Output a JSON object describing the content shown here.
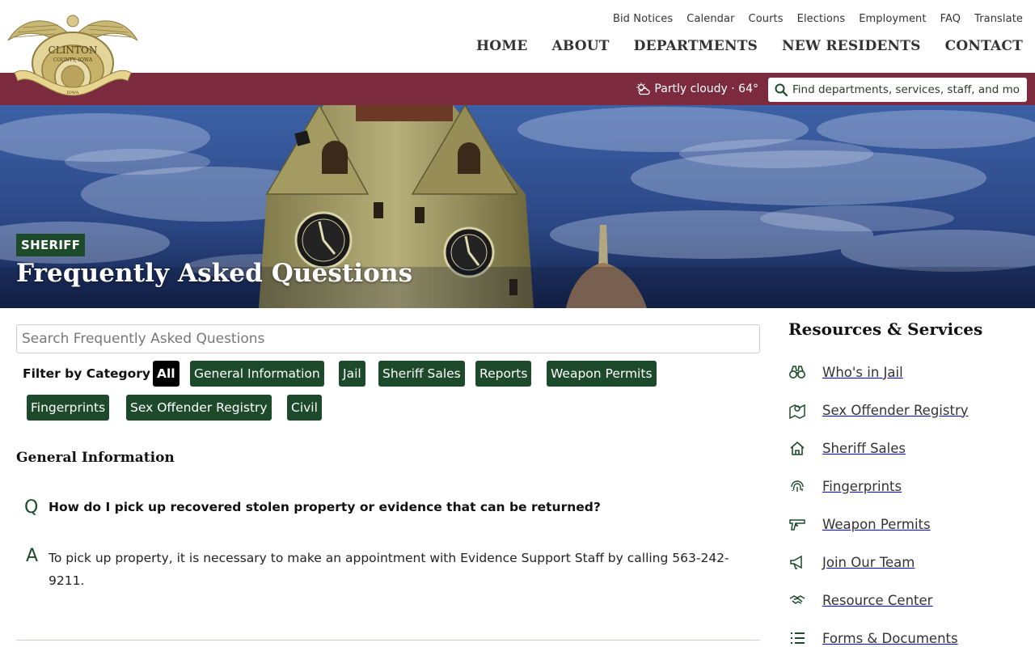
{
  "header": {
    "logo": {
      "name": "CLINTON",
      "subname": "COUNTY, IOWA",
      "seal_text": "IOWA"
    },
    "utility_nav": [
      "Bid Notices",
      "Calendar",
      "Courts",
      "Elections",
      "Employment",
      "FAQ",
      "Translate"
    ],
    "main_nav": [
      "HOME",
      "ABOUT",
      "DEPARTMENTS",
      "NEW RESIDENTS",
      "CONTACT"
    ]
  },
  "band": {
    "weather": "Partly cloudy · 64°",
    "search_placeholder": "Find departments, services, staff, and more"
  },
  "hero": {
    "tag": "SHERIFF",
    "title": "Frequently Asked Questions"
  },
  "faq": {
    "search_placeholder": "Search Frequently Asked Questions",
    "filter_label": "Filter by Category",
    "categories": [
      "All",
      "General Information",
      "Jail",
      "Sheriff Sales",
      "Reports",
      "Weapon Permits",
      "Fingerprints",
      "Sex Offender Registry",
      "Civil"
    ],
    "section_title": "General Information",
    "q_letter": "Q",
    "a_letter": "A",
    "question": "How do I pick up recovered stolen property or evidence that can be returned?",
    "answer": "To pick up property, it is necessary to make an appointment with Evidence Support Staff by calling 563-242-9211."
  },
  "sidebar": {
    "title": "Resources & Services",
    "items": [
      {
        "label": "Who's in Jail",
        "icon": "binoculars-icon"
      },
      {
        "label": "Sex Offender Registry",
        "icon": "map-pin-icon"
      },
      {
        "label": "Sheriff Sales",
        "icon": "house-icon"
      },
      {
        "label": "Fingerprints",
        "icon": "fingerprint-icon"
      },
      {
        "label": "Weapon Permits",
        "icon": "gun-icon"
      },
      {
        "label": "Join Our Team",
        "icon": "megaphone-icon"
      },
      {
        "label": "Resource Center",
        "icon": "handshake-icon"
      },
      {
        "label": "Forms & Documents",
        "icon": "list-icon"
      }
    ]
  },
  "colors": {
    "maroon_band": "#7c2b3e",
    "primary_green": "#1c4a2a",
    "active_chip": "#000000",
    "sky": "#2c4a86"
  }
}
